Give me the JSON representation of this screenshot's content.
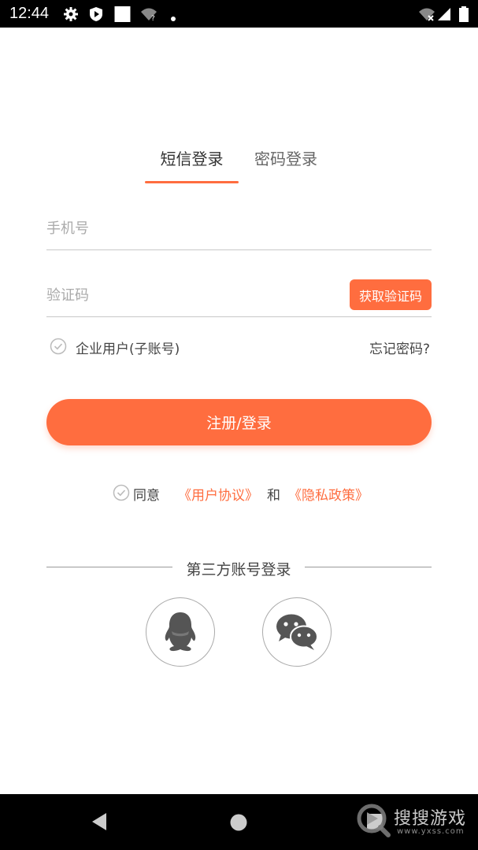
{
  "status_bar": {
    "time": "12:44",
    "icons": [
      "gear-icon",
      "shield-play-icon",
      "white-square-icon",
      "wifi-question-icon",
      "dot-icon",
      "wifi-x-icon",
      "signal-icon",
      "battery-icon"
    ]
  },
  "tabs": [
    {
      "label": "短信登录",
      "active": true
    },
    {
      "label": "密码登录",
      "active": false
    }
  ],
  "form": {
    "phone_placeholder": "手机号",
    "phone_value": "",
    "code_placeholder": "验证码",
    "code_value": "",
    "get_code_label": "获取验证码",
    "enterprise_label": "企业用户(子账号)",
    "forgot_label": "忘记密码?",
    "login_label": "注册/登录"
  },
  "agreement": {
    "agree_label": "同意",
    "user_agreement": "《用户协议》",
    "and_label": "和",
    "privacy_policy": "《隐私政策》"
  },
  "third_party": {
    "title": "第三方账号登录",
    "providers": [
      "qq-icon",
      "wechat-icon"
    ]
  },
  "watermark": {
    "text": "搜搜游戏",
    "sub": "www.yxss.com"
  },
  "colors": {
    "accent": "#ff6d3f",
    "text": "#333333",
    "placeholder": "#aaaaaa"
  }
}
